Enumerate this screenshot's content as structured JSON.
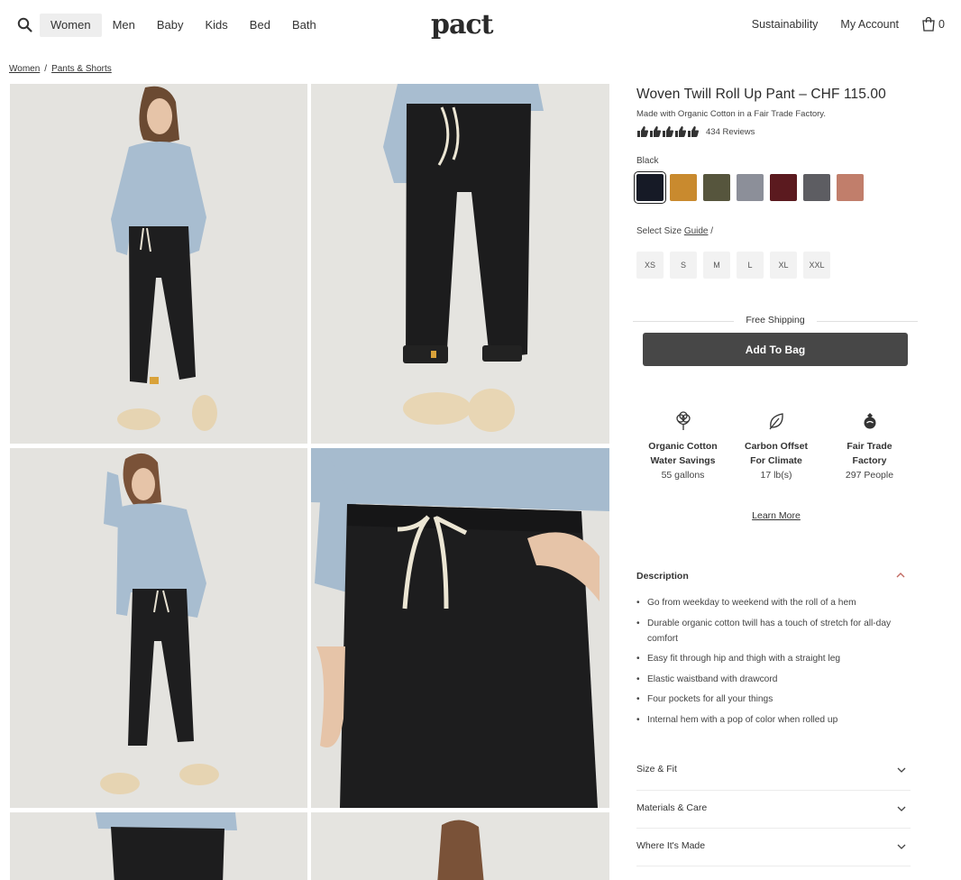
{
  "header": {
    "logo": "pact",
    "nav": [
      "Women",
      "Men",
      "Baby",
      "Kids",
      "Bed",
      "Bath"
    ],
    "active_nav": "Women",
    "sustainability": "Sustainability",
    "account": "My Account",
    "bag_count": "0"
  },
  "breadcrumb": {
    "first": "Women",
    "separator": "/",
    "second": "Pants & Shorts"
  },
  "product": {
    "title": "Woven Twill Roll Up Pant – CHF 115.00",
    "subtitle": "Made with Organic Cotton in a Fair Trade Factory.",
    "reviews": "434 Reviews",
    "rating_icons": 5,
    "color_label": "Black",
    "swatches": [
      "#161a26",
      "#c98a2e",
      "#56553d",
      "#8c8f99",
      "#5b1a1f",
      "#5d5d62",
      "#c17e6b"
    ],
    "size_label_prefix": "Select Size ",
    "size_guide": "Guide",
    "size_label_suffix": " /",
    "sizes": [
      "XS",
      "S",
      "M",
      "L",
      "XL",
      "XXL"
    ],
    "shipping": "Free Shipping",
    "add_to_bag": "Add To Bag"
  },
  "impact": [
    {
      "icon": "cotton-icon",
      "line1": "Organic Cotton",
      "line2": "Water Savings",
      "value": "55 gallons"
    },
    {
      "icon": "leaf-icon",
      "line1": "Carbon Offset",
      "line2": "For Climate",
      "value": "17 lb(s)"
    },
    {
      "icon": "fair-trade-icon",
      "line1": "Fair Trade",
      "line2": "Factory",
      "value": "297 People"
    }
  ],
  "learn_more": "Learn More",
  "description": {
    "heading": "Description",
    "bullets": [
      "Go from weekday to weekend with the roll of a hem",
      "Durable organic cotton twill has a touch of stretch for all-day comfort",
      "Easy fit through hip and thigh with a straight leg",
      "Elastic waistband with drawcord",
      "Four pockets for all your things",
      "Internal hem with a pop of color when rolled up"
    ]
  },
  "accordions": [
    "Size & Fit",
    "Materials & Care",
    "Where It's Made"
  ]
}
